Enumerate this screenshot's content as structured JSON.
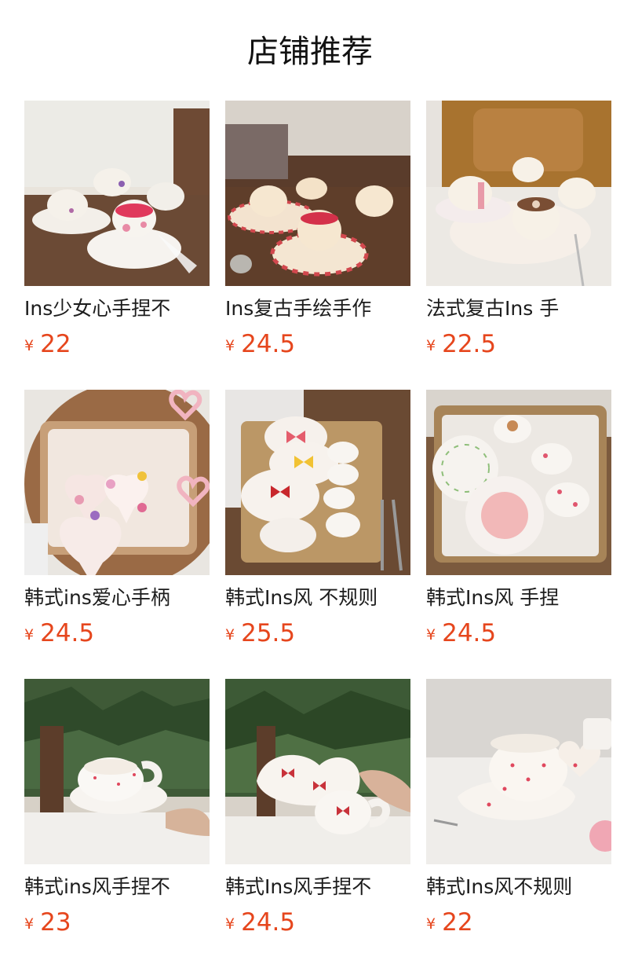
{
  "section": {
    "title": "店铺推荐"
  },
  "currency_symbol": "¥",
  "products": [
    {
      "name": "Ins少女心手捏不",
      "price": "22"
    },
    {
      "name": "Ins复古手绘手作",
      "price": "24.5"
    },
    {
      "name": "法式复古Ins 手",
      "price": "22.5"
    },
    {
      "name": "韩式ins爱心手柄",
      "price": "24.5"
    },
    {
      "name": "韩式Ins风 不规则",
      "price": "25.5"
    },
    {
      "name": "韩式Ins风 手捏",
      "price": "24.5"
    },
    {
      "name": "韩式ins风手捏不",
      "price": "23"
    },
    {
      "name": "韩式Ins风手捏不",
      "price": "24.5"
    },
    {
      "name": "韩式Ins风不规则",
      "price": "22"
    }
  ],
  "colors": {
    "price": "#e6461d",
    "title": "#111111"
  }
}
